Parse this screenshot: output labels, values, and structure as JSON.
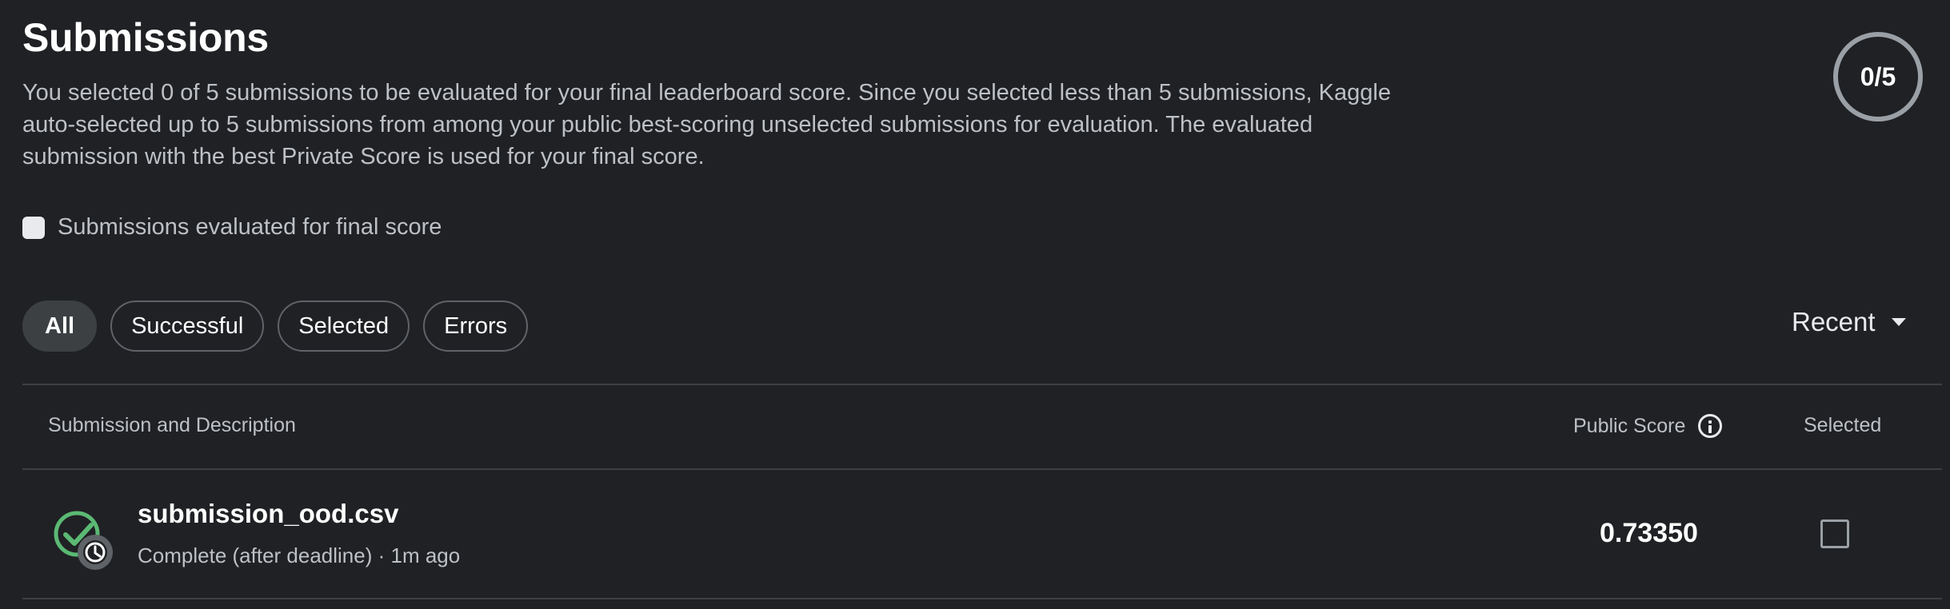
{
  "header": {
    "title": "Submissions",
    "description": "You selected 0 of 5 submissions to be evaluated for your final leaderboard score. Since you selected less than 5 submissions, Kaggle auto-selected up to 5 submissions from among your public best-scoring unselected submissions for evaluation. The evaluated submission with the best Private Score is used for your final score.",
    "counter": "0/5"
  },
  "final_filter": {
    "label": "Submissions evaluated for final score",
    "checked": false
  },
  "filters": {
    "chips": [
      "All",
      "Successful",
      "Selected",
      "Errors"
    ],
    "active": "All"
  },
  "sort": {
    "label": "Recent",
    "icon": "caret-down-icon"
  },
  "table": {
    "headers": {
      "description": "Submission and Description",
      "public_score": "Public Score",
      "selected": "Selected"
    },
    "rows": [
      {
        "filename": "submission_ood.csv",
        "status_text": "Complete (after deadline) · 1m ago",
        "public_score": "0.73350",
        "selected": false,
        "icon": "complete-late-status-icon"
      }
    ]
  },
  "colors": {
    "background": "#202124",
    "success_green": "#5bb974",
    "muted_text": "#bdc1c6",
    "border": "#3c4043"
  }
}
